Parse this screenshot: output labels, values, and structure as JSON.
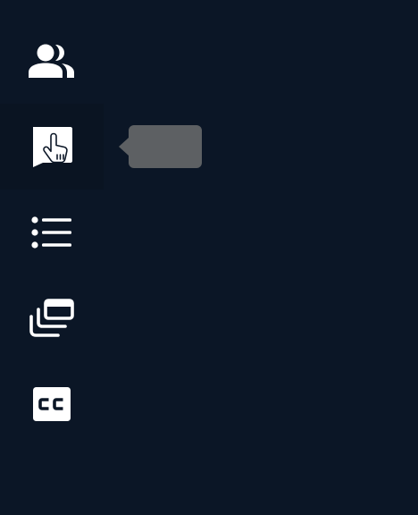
{
  "colors": {
    "background": "#0b1626",
    "active_background": "#0a1422",
    "icon": "#ffffff",
    "tooltip_background": "#5d6063"
  },
  "rail": {
    "items": [
      {
        "icon": "people-icon",
        "active": false
      },
      {
        "icon": "raise-hand-icon",
        "active": true
      },
      {
        "icon": "list-icon",
        "active": false
      },
      {
        "icon": "picture-in-picture-icon",
        "active": false
      },
      {
        "icon": "closed-captions-icon",
        "active": false
      }
    ]
  },
  "tooltip": {
    "text": ""
  }
}
